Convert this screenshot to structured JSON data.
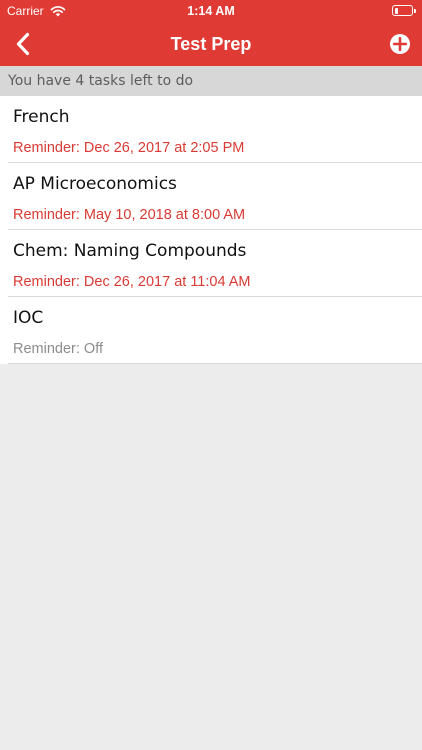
{
  "status_bar": {
    "carrier": "Carrier",
    "time": "1:14 AM",
    "battery_level": 0.2
  },
  "nav": {
    "title": "Test Prep",
    "back_icon": "chevron-left-icon",
    "add_icon": "plus-circle-icon"
  },
  "summary": {
    "text": "You have 4 tasks left to do"
  },
  "tasks": [
    {
      "title": "French",
      "reminder": "Reminder: Dec 26, 2017 at 2:05 PM",
      "reminder_active": true
    },
    {
      "title": "AP Microeconomics",
      "reminder": "Reminder: May 10, 2018 at 8:00 AM",
      "reminder_active": true
    },
    {
      "title": "Chem: Naming Compounds",
      "reminder": "Reminder: Dec 26, 2017 at 11:04 AM",
      "reminder_active": true
    },
    {
      "title": "IOC",
      "reminder": "Reminder: Off",
      "reminder_active": false
    }
  ],
  "colors": {
    "header_red": "#e03a35",
    "reminder_red": "#d93a34",
    "summary_bg": "#d7d7d7",
    "page_bg": "#ececec"
  }
}
